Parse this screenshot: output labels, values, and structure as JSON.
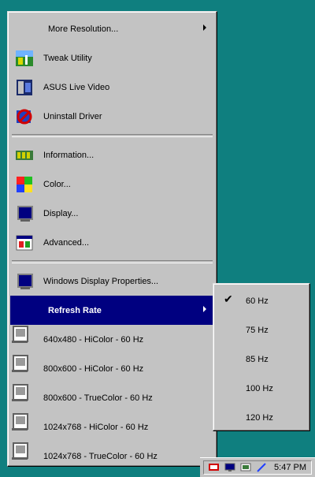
{
  "menu": {
    "items": [
      {
        "label": "More Resolution...",
        "has_submenu": true,
        "icon": "none"
      },
      {
        "label": "Tweak Utility",
        "icon": "tweak-utility-icon"
      },
      {
        "label": "ASUS Live Video",
        "icon": "live-video-icon"
      },
      {
        "label": "Uninstall Driver",
        "icon": "uninstall-icon"
      },
      {
        "label": "Information...",
        "icon": "information-icon"
      },
      {
        "label": "Color...",
        "icon": "color-icon"
      },
      {
        "label": "Display...",
        "icon": "display-icon"
      },
      {
        "label": "Advanced...",
        "icon": "advanced-icon"
      },
      {
        "label": "Windows Display Properties...",
        "icon": "monitor-icon"
      },
      {
        "label": "Refresh Rate",
        "has_submenu": true,
        "selected": true,
        "icon": "none"
      },
      {
        "label": "640x480 - HiColor - 60 Hz",
        "icon": "computer-icon"
      },
      {
        "label": "800x600 - HiColor - 60 Hz",
        "icon": "computer-icon"
      },
      {
        "label": "800x600 - TrueColor - 60 Hz",
        "icon": "computer-icon"
      },
      {
        "label": "1024x768 - HiColor - 60 Hz",
        "icon": "computer-icon"
      },
      {
        "label": "1024x768 - TrueColor - 60 Hz",
        "icon": "computer-icon"
      }
    ]
  },
  "submenu": {
    "items": [
      {
        "label": "60 Hz",
        "checked": true
      },
      {
        "label": "75 Hz"
      },
      {
        "label": "85 Hz"
      },
      {
        "label": "100 Hz"
      },
      {
        "label": "120 Hz"
      }
    ]
  },
  "taskbar": {
    "clock": "5:47 PM"
  },
  "colors": {
    "desktop": "#0f7f7f",
    "menu": "#c3c3c3",
    "highlight": "#000080"
  }
}
